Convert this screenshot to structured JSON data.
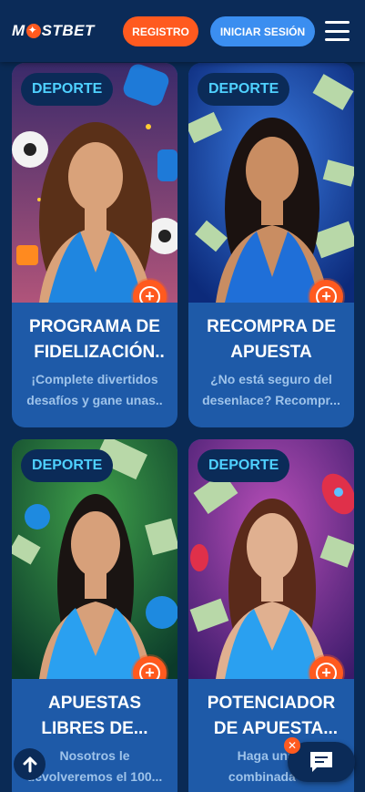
{
  "header": {
    "logo_text_left": "M",
    "logo_text_right": "STBET",
    "register_label": "REGISTRO",
    "login_label": "INICIAR SESIÓN",
    "menu_icon": "hamburger-menu-icon"
  },
  "colors": {
    "background": "#0a2a55",
    "header": "#0b2b58",
    "card": "#1e5aa8",
    "accent_orange": "#ff5a1f",
    "accent_blue": "#3b8ef0",
    "badge_text": "#4fd1ff"
  },
  "cards": [
    {
      "badge": "DEPORTE",
      "title_line1": "PROGRAMA DE",
      "title_line2": "FIDELIZACIÓN..",
      "desc_line1": "¡Complete divertidos",
      "desc_line2": "desafíos y gane unas.."
    },
    {
      "badge": "DEPORTE",
      "title_line1": "RECOMPRA DE",
      "title_line2": "APUESTA",
      "desc_line1": "¿No está seguro del",
      "desc_line2": "desenlace? Recompr..."
    },
    {
      "badge": "DEPORTE",
      "title_line1": "APUESTAS",
      "title_line2": "LIBRES DE...",
      "desc_line1": "Nosotros le",
      "desc_line2": "devolveremos el 100..."
    },
    {
      "badge": "DEPORTE",
      "title_line1": "POTENCIADOR",
      "title_line2": "DE APUESTA...",
      "desc_line1": "Haga una a",
      "desc_line2": "combinada en"
    }
  ],
  "floating": {
    "scroll_up_icon": "arrow-up-icon",
    "chat_icon": "chat-icon",
    "close_icon": "close-icon"
  }
}
